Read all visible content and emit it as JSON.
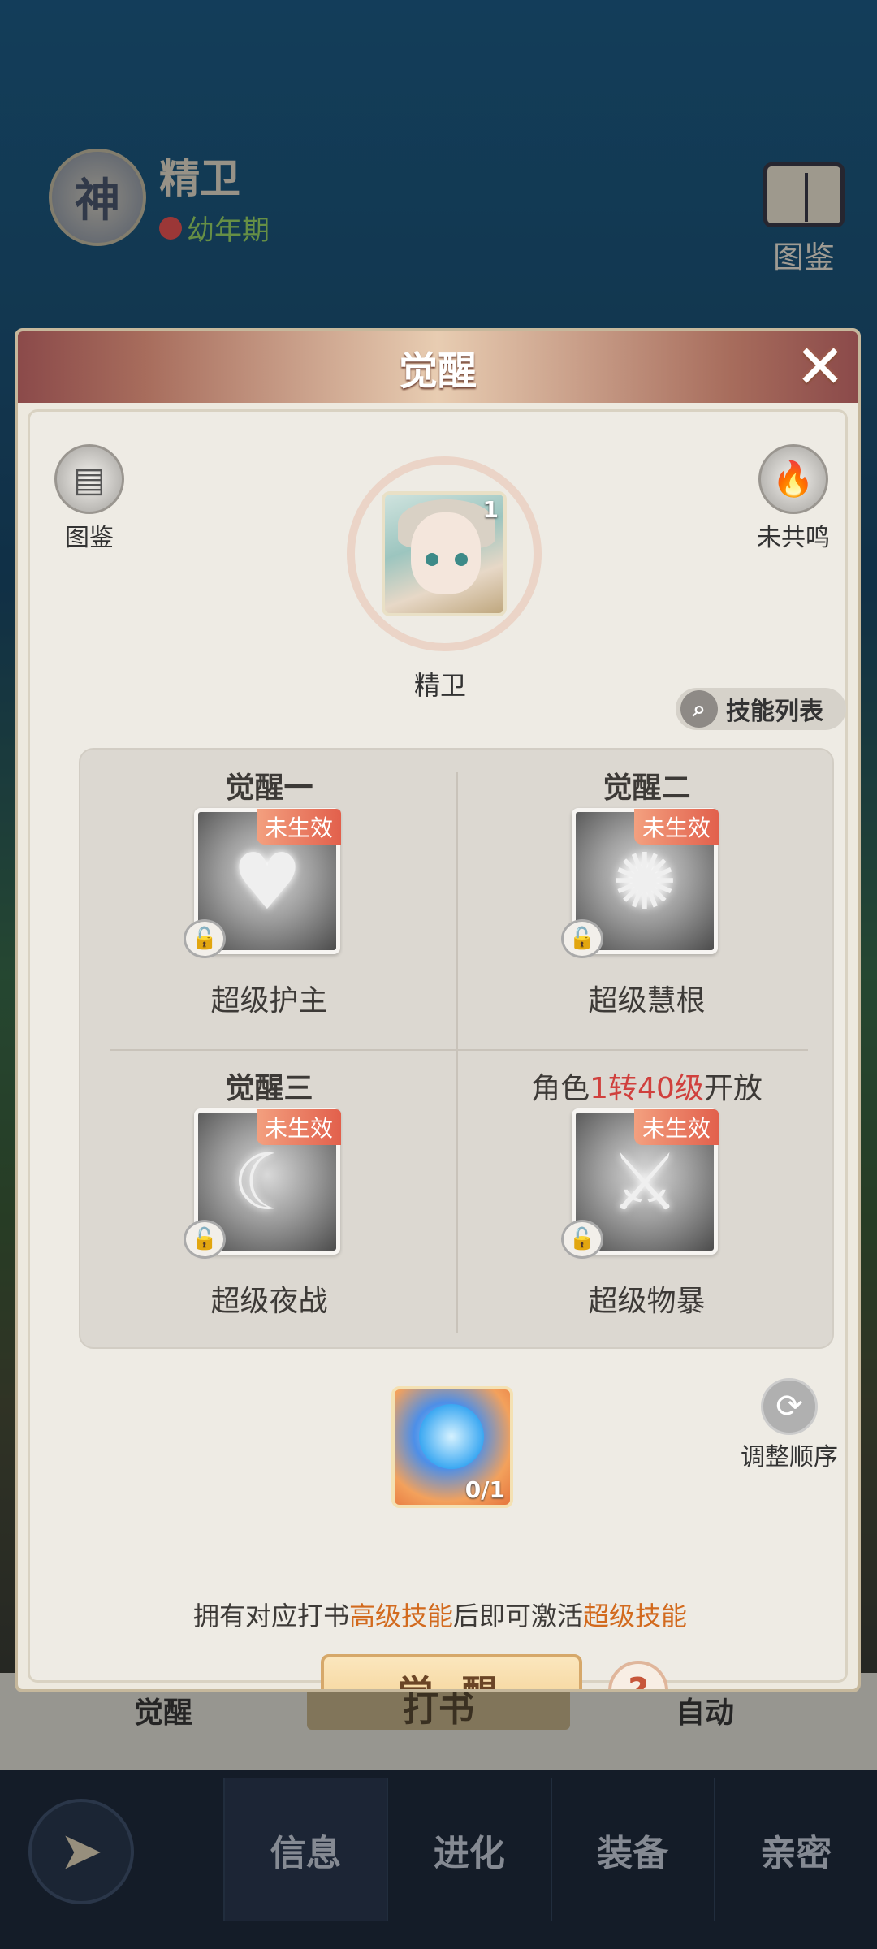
{
  "background": {
    "pet_name": "精卫",
    "pet_badge": "神",
    "stage": "幼年期",
    "atlas_label": "图鉴",
    "under_left": "觉醒",
    "under_mid": "打书",
    "under_right": "自动",
    "nav_tabs": [
      "信息",
      "进化",
      "装备",
      "亲密"
    ]
  },
  "modal": {
    "title": "觉醒",
    "atlas_label": "图鉴",
    "resonance_label": "未共鸣",
    "pet_name": "精卫",
    "pet_level": "1",
    "skill_list_label": "技能列表",
    "slots": [
      {
        "title": "觉醒一",
        "tag": "未生效",
        "name": "超级护主",
        "icon": "heart-hands-icon"
      },
      {
        "title": "觉醒二",
        "tag": "未生效",
        "name": "超级慧根",
        "icon": "brain-icon"
      },
      {
        "title": "觉醒三",
        "tag": "未生效",
        "name": "超级夜战",
        "icon": "crescent-moon-icon"
      },
      {
        "title_pre": "角色",
        "title_hl": "1转40级",
        "title_post": "开放",
        "tag": "未生效",
        "name": "超级物暴",
        "icon": "axe-icon"
      }
    ],
    "item_count": "0/1",
    "reorder_label": "调整顺序",
    "hint": {
      "p1": "拥有对应打书",
      "h1": "高级技能",
      "p2": "后即可激活",
      "h2": "超级技能"
    },
    "awaken_button": "觉 醒",
    "help": "?"
  }
}
